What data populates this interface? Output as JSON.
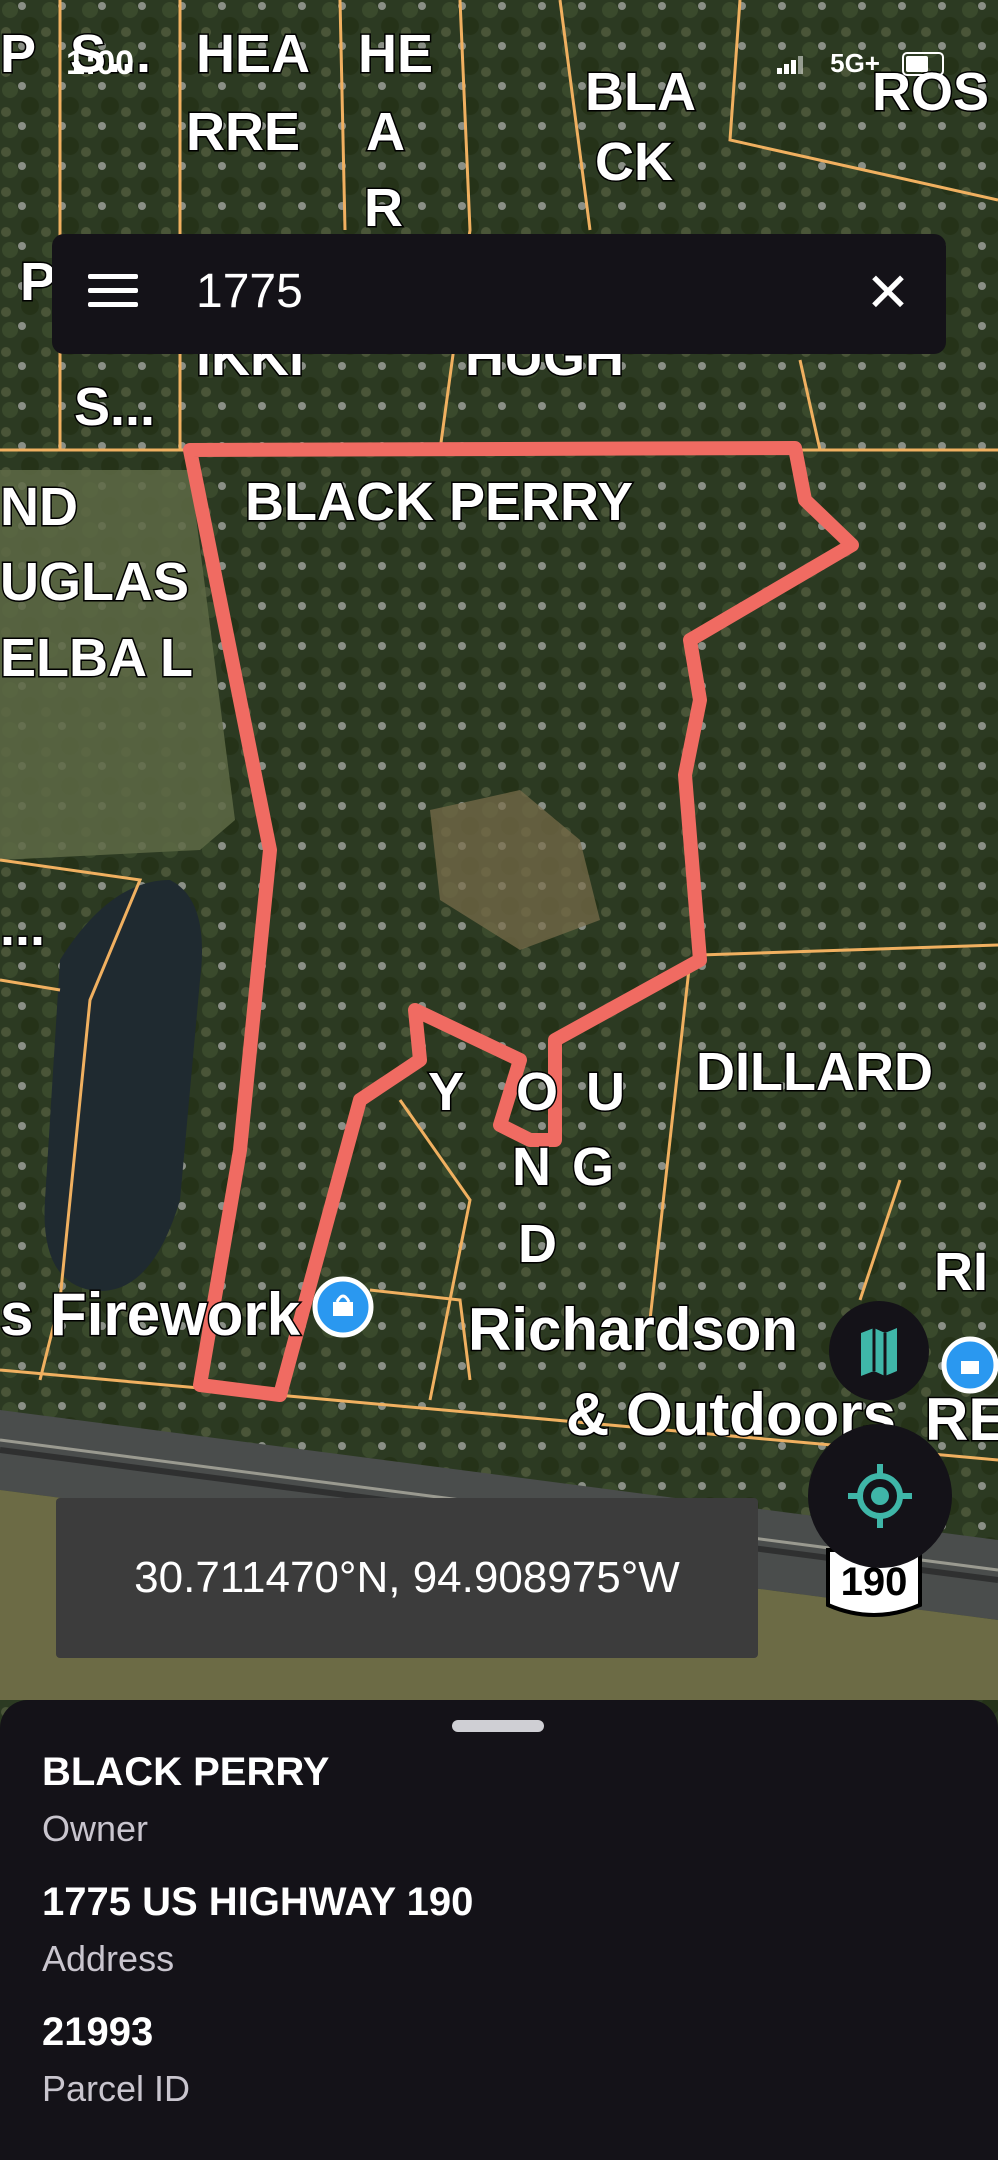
{
  "status_bar": {
    "time": "1:00",
    "network": "5G+"
  },
  "search": {
    "query": "1775",
    "menu_icon": "menu-icon",
    "close_icon": "close-icon"
  },
  "map": {
    "parcel_labels": [
      "P",
      "S...",
      "HEA",
      "RRE",
      "HE",
      "A",
      "R",
      "BLA",
      "CK",
      "ROS",
      "P",
      "IKKI",
      "HUGH",
      "S...",
      "BLACK PERRY",
      "ND",
      "UGLAS",
      "ELBA L",
      "...",
      "Y",
      "O",
      "U",
      "N",
      "G",
      "D",
      "DILLARD",
      "RI"
    ],
    "poi_labels": [
      "s Firework",
      "Richardson",
      "& Outdoors",
      "RE"
    ],
    "highway_shield": "190",
    "coordinate_readout": "30.711470°N, 94.908975°W",
    "colors": {
      "parcel_line": "#f0b060",
      "selected_parcel": "#f06b62",
      "poi_pin": "#2a98f0",
      "fab_accent": "#3fb6a8"
    }
  },
  "buttons": {
    "layers_icon": "map-layers-icon",
    "location_icon": "my-location-icon"
  },
  "sheet": {
    "owner_value": "BLACK PERRY",
    "owner_label": "Owner",
    "address_value": "1775 US HIGHWAY 190",
    "address_label": "Address",
    "parcel_value": "21993",
    "parcel_label": "Parcel ID"
  }
}
